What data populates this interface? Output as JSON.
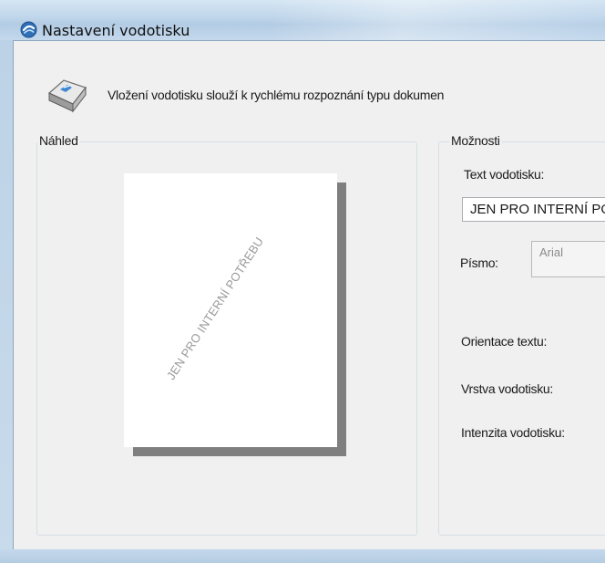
{
  "window": {
    "title": "Nastavení vodotisku"
  },
  "header": {
    "description": "Vložení vodotisku slouží k rychlému rozpoznání typu dokumen",
    "icon": "keyboard-key-icon"
  },
  "preview": {
    "group_label": "Náhled",
    "watermark_text": "JEN PRO INTERNÍ POTŘEBU"
  },
  "options": {
    "group_label": "Možnosti",
    "text_label": "Text vodotisku:",
    "text_value": "JEN PRO INTERNÍ POTŘEBU",
    "font_label": "Písmo:",
    "font_value": "Arial",
    "orientation_label": "Orientace textu:",
    "layer_label": "Vrstva vodotisku:",
    "intensity_label": "Intenzita vodotisku:"
  },
  "colors": {
    "title_bar": "#bed5ea",
    "client_bg": "#f0f0f0",
    "watermark": "#9a9a9a"
  }
}
